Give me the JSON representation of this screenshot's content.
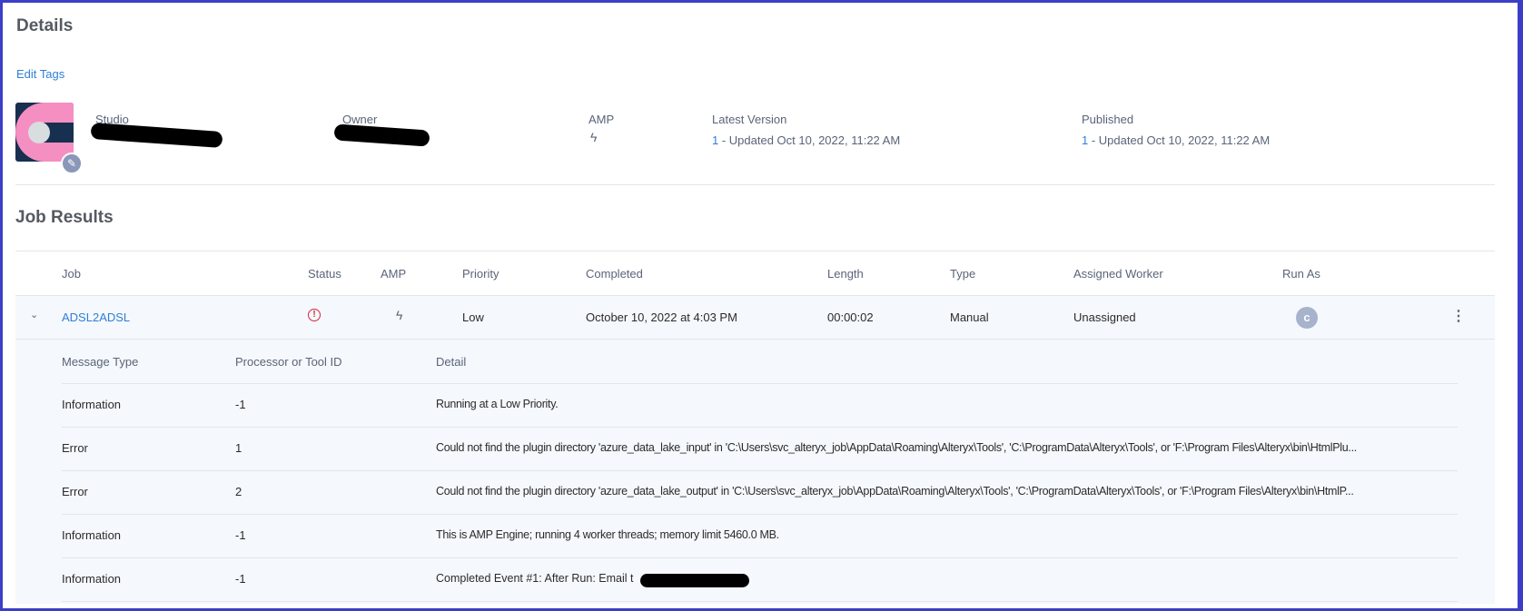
{
  "details": {
    "title": "Details",
    "edit_tags": "Edit Tags",
    "studio_label": "Studio",
    "owner_label": "Owner",
    "amp_label": "AMP",
    "latest_version_label": "Latest Version",
    "latest_version_num": "1",
    "latest_version_text": " - Updated Oct 10, 2022, 11:22 AM",
    "published_label": "Published",
    "published_num": "1",
    "published_text": " - Updated Oct 10, 2022, 11:22 AM"
  },
  "job_results": {
    "title": "Job Results",
    "columns": [
      "Job",
      "Status",
      "AMP",
      "Priority",
      "Completed",
      "Length",
      "Type",
      "Assigned Worker",
      "Run As"
    ],
    "row": {
      "job": "ADSL2ADSL",
      "status": "error",
      "priority": "Low",
      "completed": "October 10, 2022 at 4:03 PM",
      "length": "00:00:02",
      "type": "Manual",
      "worker": "Unassigned",
      "run_as": "c"
    },
    "messages": {
      "columns": [
        "Message Type",
        "Processor or Tool ID",
        "Detail"
      ],
      "rows": [
        {
          "type": "Information",
          "id": "-1",
          "detail": "Running at a Low Priority."
        },
        {
          "type": "Error",
          "id": "1",
          "detail": "Could not find the plugin directory 'azure_data_lake_input' in 'C:\\Users\\svc_alteryx_job\\AppData\\Roaming\\Alteryx\\Tools', 'C:\\ProgramData\\Alteryx\\Tools', or 'F:\\Program Files\\Alteryx\\bin\\HtmlPlu..."
        },
        {
          "type": "Error",
          "id": "2",
          "detail": "Could not find the plugin directory 'azure_data_lake_output' in 'C:\\Users\\svc_alteryx_job\\AppData\\Roaming\\Alteryx\\Tools', 'C:\\ProgramData\\Alteryx\\Tools', or 'F:\\Program Files\\Alteryx\\bin\\HtmlP..."
        },
        {
          "type": "Information",
          "id": "-1",
          "detail": "This is AMP Engine; running 4 worker threads; memory limit 5460.0 MB."
        },
        {
          "type": "Information",
          "id": "-1",
          "detail": "Completed Event #1: After Run: Email t"
        }
      ]
    }
  },
  "colors": {
    "accent": "#2f7fd6",
    "error": "#d6293a",
    "border": "#3d3dc8"
  }
}
